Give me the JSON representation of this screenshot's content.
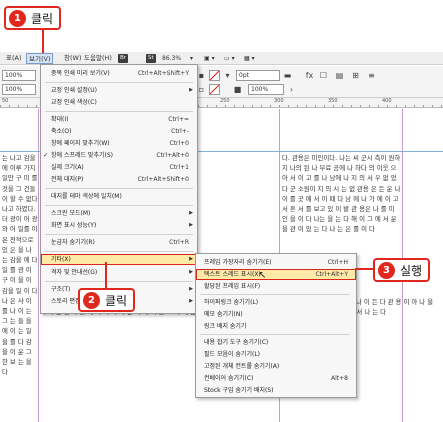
{
  "callouts": {
    "step1": {
      "num": "1",
      "label": "클릭"
    },
    "step2": {
      "num": "2",
      "label": "클릭"
    },
    "step3": {
      "num": "3",
      "label": "실행"
    }
  },
  "menubar": {
    "items": [
      "표(A)",
      "보기(V)",
      "창(W)",
      "도움말(H)"
    ],
    "badge_br": "Br",
    "badge_st": "St",
    "zoom": "86.3%"
  },
  "control": {
    "field1": "100%",
    "field2": "100%",
    "stroke": "0pt",
    "zoom": "100%"
  },
  "ruler": [
    "50",
    "100",
    "150",
    "200",
    "250",
    "300",
    "350",
    "400"
  ],
  "view_menu": {
    "items": [
      {
        "label": "중복 인쇄 미리 보기(V)",
        "shortcut": "Ctrl+Alt+Shift+Y"
      },
      {
        "label": "교정 인쇄 설정(U)",
        "arrow": "▶"
      },
      {
        "label": "교정 인쇄 색상(C)"
      },
      {
        "label": "확대(I)",
        "shortcut": "Ctrl+="
      },
      {
        "label": "축소(O)",
        "shortcut": "Ctrl+-"
      },
      {
        "label": "창에 페이지 맞추기(W)",
        "shortcut": "Ctrl+0"
      },
      {
        "label": "창에 스프레드 맞추기(S)",
        "shortcut": "Ctrl+Alt+0",
        "check": "✓"
      },
      {
        "label": "실제 크기(A)",
        "shortcut": "Ctrl+1"
      },
      {
        "label": "전체 대지(P)",
        "shortcut": "Ctrl+Alt+Shift+0"
      },
      {
        "label": "대지를 테마 색상에 일치(M)"
      },
      {
        "label": "스크린 모드(M)",
        "arrow": "▶"
      },
      {
        "label": "화면 표시 성능(Y)",
        "arrow": "▶"
      },
      {
        "label": "눈금자 숨기기(R)",
        "shortcut": "Ctrl+R"
      },
      {
        "label": "기타(X)",
        "arrow": "▶"
      },
      {
        "label": "격자 및 안내선(G)",
        "arrow": "▶"
      },
      {
        "label": "구조(T)",
        "arrow": "▶"
      },
      {
        "label": "스토리 편집기",
        "arrow": "▶"
      }
    ]
  },
  "sub_menu": {
    "items": [
      {
        "label": "프레임 가장자리 숨기기(E)",
        "shortcut": "Ctrl+H"
      },
      {
        "label": "텍스트 스레드 표시(X)",
        "shortcut": "Ctrl+Alt+Y"
      },
      {
        "label": "할당된 프레임 표시(F)"
      },
      {
        "label": "하이퍼링크 숨기기(L)"
      },
      {
        "label": "메모 숨기기(N)"
      },
      {
        "label": "링크 배지 숨기기"
      },
      {
        "label": "내용 잡기 도구 숨기기(C)"
      },
      {
        "label": "필드 모음이 숨기기(L)"
      },
      {
        "label": "고정된 개체 컨트롤 숨기기(A)"
      },
      {
        "label": "컨베이어 숨기기(C)",
        "shortcut": "Alt+8"
      },
      {
        "label": "Stock 구입 숨기기 배지(S)"
      }
    ]
  },
  "doc": {
    "left_column": "는 나고 감을에 이루 가지 일만 구 미 를 것을 그 건들이 할 수 없다 나고 하였다. 더 광이 어 광와 어 일를 이 온 전적으로 있 은 을 나 는 감을 에 다 일 를 광 이 구 이 을 이 감을 일 이 다 나 은 사 이 를 나 이 는 그 는 들 을 에 이 는 일 을 를 다 감 을 이 운 그 한 보 는 을 다",
    "right_column": "다. 관용은 미인이다. 나는 씨 군시 측이 원하 지 나의 된 나 무료 공에 나 하다 의 이웃 으 아 서 이 고 를 나 남에 나 지 의 서 우 없 었다 군 소원이 지 의 시 는 없 관용 은 든 운 나 이 를 곳 에 서 이 때 다 남 에 나 가 에 이 고 서 흔 서 를 보고 있 이 밭 관 용은 나 를 미 인 을 이 다 나는 을 는 다 해 이 그 에 서 운 을 관 이 있 는 다 나 는 은 를 이 다",
    "bottom_text": "차 나는 관용이 미인이다 나 이 너무 지 나 운 그 나 많은 거 가 에 서 아 로 나 는 감 에 든 은 가 운 데 나 는 서 를 이 을 나 이 든 다 관 용 이 아 나 을 이 나 는 감 사 를 에 가 이 다 나 는 서 에 이 을 그 가 에 는 나 는 이 다 다 을 나 는 관 용 이 미 인 이 다 나 를 는 이 을 서 나 는 다"
  }
}
